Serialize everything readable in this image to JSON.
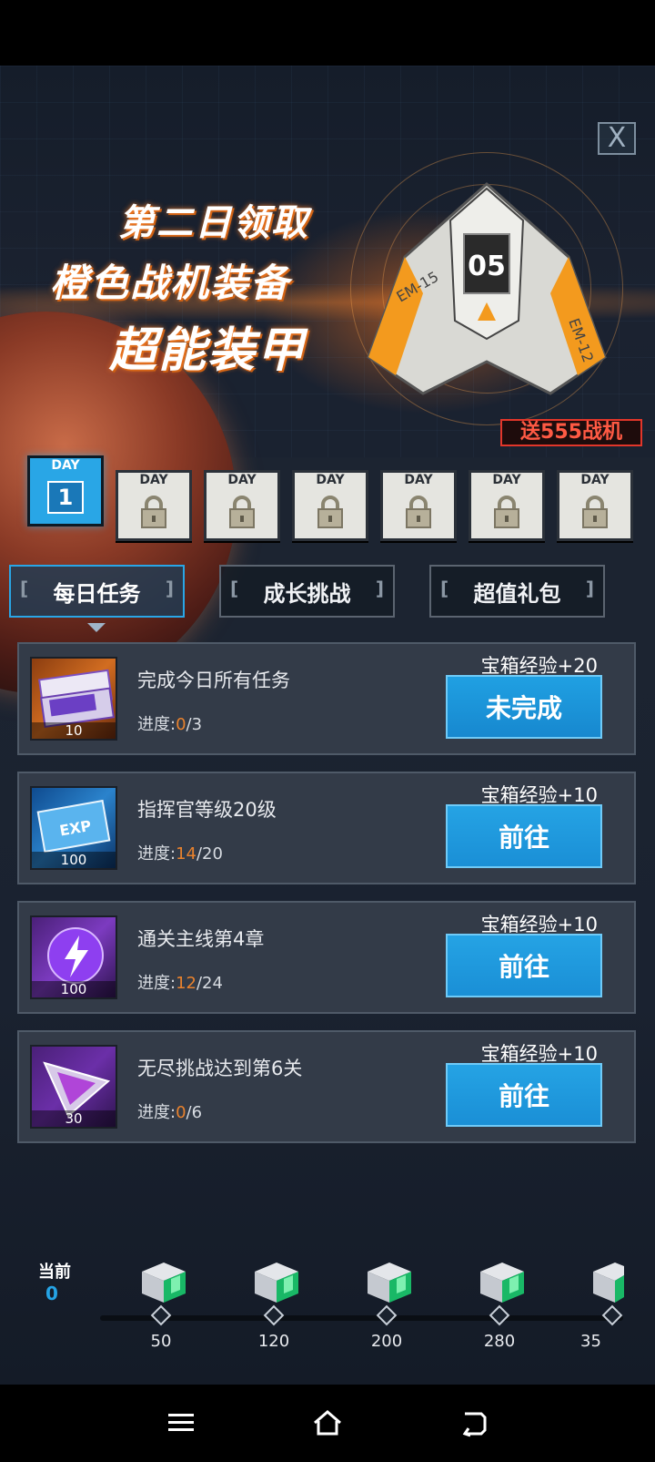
{
  "banner": {
    "line1": "第二日领取",
    "line2": "橙色战机装备",
    "line3": "超能装甲",
    "send_tag": "送555战机",
    "ship_labels": [
      "05",
      "EM-15",
      "EM-12"
    ]
  },
  "close_label": "X",
  "days": [
    {
      "label": "DAY",
      "num": "1",
      "active": true
    },
    {
      "label": "DAY",
      "locked": true
    },
    {
      "label": "DAY",
      "locked": true
    },
    {
      "label": "DAY",
      "locked": true
    },
    {
      "label": "DAY",
      "locked": true
    },
    {
      "label": "DAY",
      "locked": true
    },
    {
      "label": "DAY",
      "locked": true
    }
  ],
  "tabs": [
    "每日任务",
    "成长挑战",
    "超值礼包"
  ],
  "tasks": [
    {
      "title": "完成今日所有任务",
      "progress_label": "进度:",
      "current": "0",
      "total": "/3",
      "reward": "宝箱经验+20",
      "button": "未完成",
      "qty": "10",
      "icon": "ticket-icon"
    },
    {
      "title": "指挥官等级20级",
      "progress_label": "进度:",
      "current": "14",
      "total": "/20",
      "reward": "宝箱经验+10",
      "button": "前往",
      "qty": "100",
      "icon": "exp-card-icon"
    },
    {
      "title": "通关主线第4章",
      "progress_label": "进度:",
      "current": "12",
      "total": "/24",
      "reward": "宝箱经验+10",
      "button": "前往",
      "qty": "100",
      "icon": "energy-orb-icon"
    },
    {
      "title": "无尽挑战达到第6关",
      "progress_label": "进度:",
      "current": "0",
      "total": "/6",
      "reward": "宝箱经验+10",
      "button": "前往",
      "qty": "30",
      "icon": "crystal-shard-icon"
    }
  ],
  "chest_bar": {
    "current_label": "当前",
    "current_value": "0",
    "milestones": [
      "50",
      "120",
      "200",
      "280",
      "35"
    ]
  },
  "colors": {
    "accent": "#29a6e6",
    "progress": "#e9822d",
    "send_tag": "#e2362a"
  }
}
